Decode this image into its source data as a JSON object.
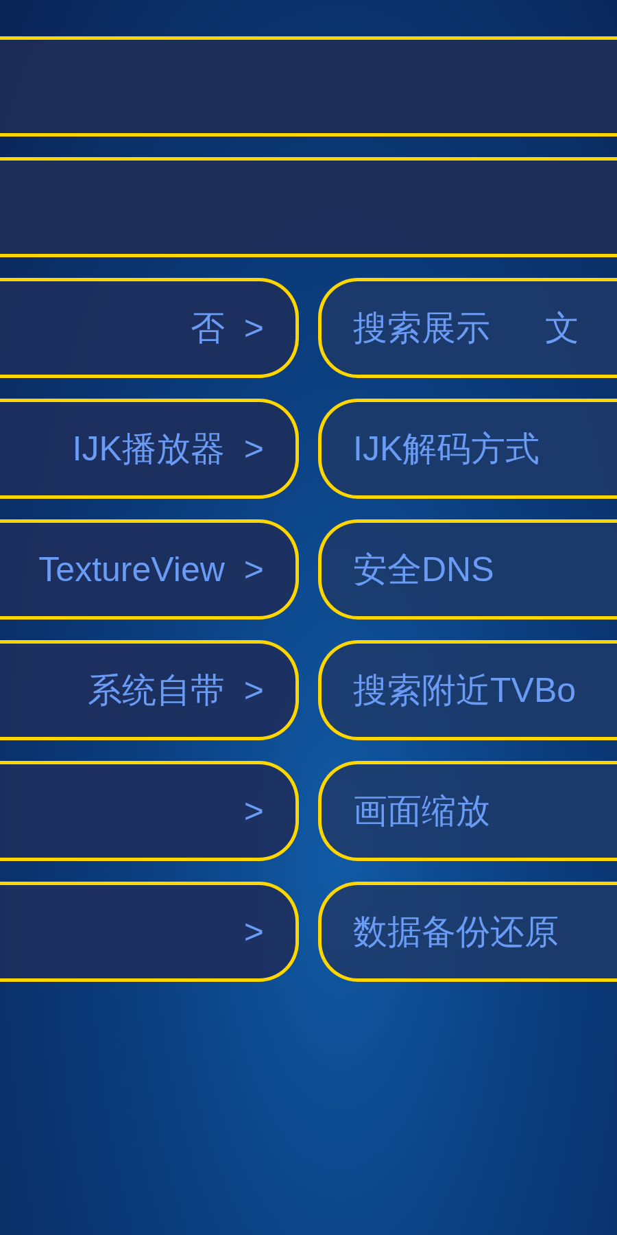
{
  "header_bars": [
    {
      "kind": "empty"
    },
    {
      "kind": "empty"
    }
  ],
  "rows": [
    {
      "left": {
        "value": "否",
        "arrow": ">"
      },
      "right": {
        "label": "搜索展示",
        "value": "文"
      }
    },
    {
      "left": {
        "value": "IJK播放器",
        "arrow": ">"
      },
      "right": {
        "label": "IJK解码方式"
      }
    },
    {
      "left": {
        "value": "TextureView",
        "arrow": ">"
      },
      "right": {
        "label": "安全DNS"
      }
    },
    {
      "left": {
        "value": "系统自带",
        "arrow": ">"
      },
      "right": {
        "label": "搜索附近TVBo"
      }
    },
    {
      "left": {
        "arrow": ">"
      },
      "right": {
        "label": "画面缩放"
      }
    },
    {
      "left": {
        "arrow": ">"
      },
      "right": {
        "label": "数据备份还原"
      }
    }
  ]
}
